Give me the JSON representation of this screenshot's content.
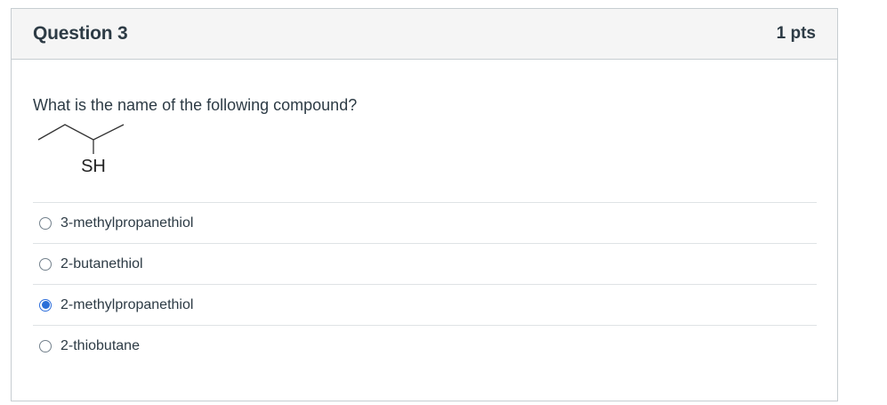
{
  "question": {
    "title": "Question 3",
    "points": "1 pts",
    "prompt": "What is the name of the following compound?",
    "structure_label": "SH",
    "selected_color": "#2a6fd8",
    "answers": [
      {
        "label": "3-methylpropanethiol",
        "selected": false
      },
      {
        "label": "2-butanethiol",
        "selected": false
      },
      {
        "label": "2-methylpropanethiol",
        "selected": true
      },
      {
        "label": "2-thiobutane",
        "selected": false
      }
    ]
  }
}
